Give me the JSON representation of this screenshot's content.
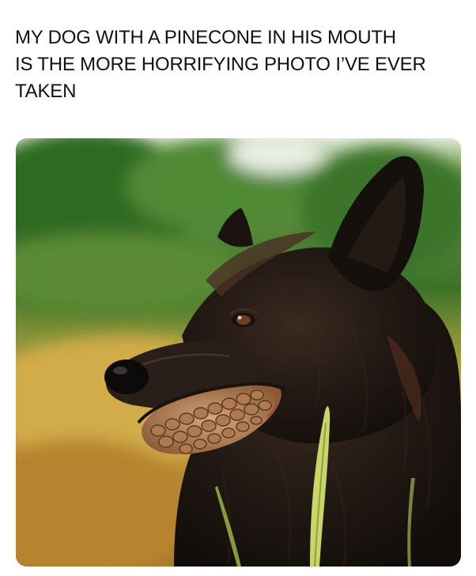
{
  "caption": {
    "lines": [
      "MY DOG WITH A PINECONE IN HIS MOUTH",
      "IS THE MORE HORRIFYING PHOTO I’VE EVER",
      "TAKEN"
    ]
  },
  "photo": {
    "subject": "dog-with-pinecone",
    "colors": {
      "sky": "#e8efe0",
      "foliage": "#3f7a2c",
      "field": "#c79a3a",
      "fur": "#1f1712",
      "pinecone": "#c4926a"
    }
  }
}
